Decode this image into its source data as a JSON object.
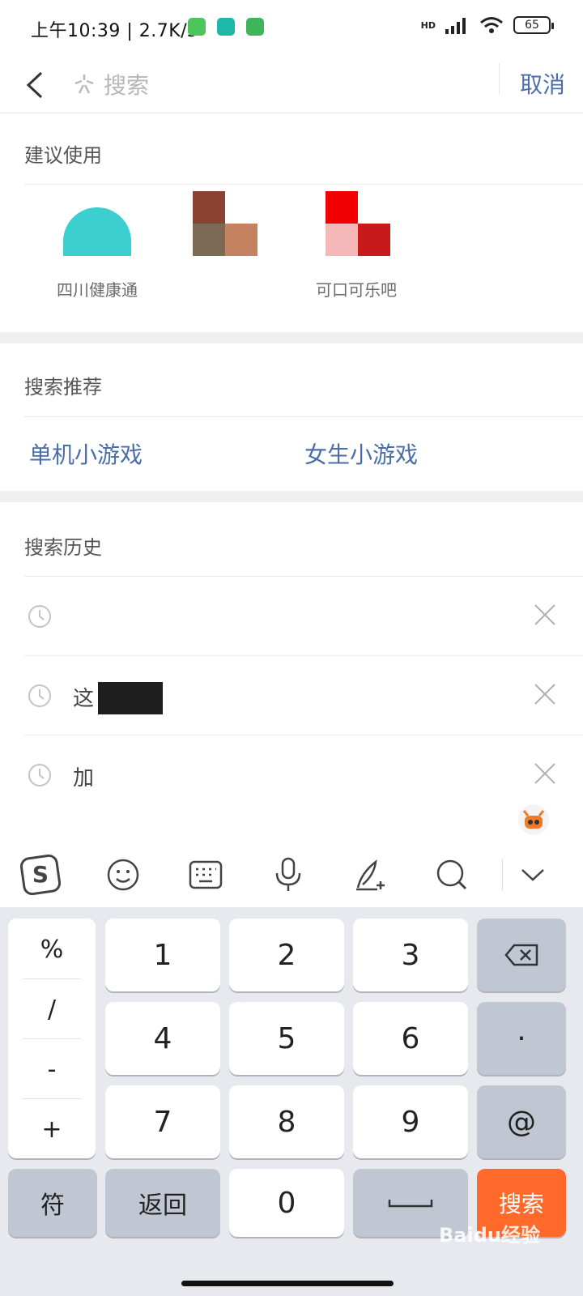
{
  "status_bar": {
    "time": "上午10:39 | 2.7K/s",
    "battery": "65",
    "network_label": "HD"
  },
  "header": {
    "search_placeholder": "搜索",
    "cancel_label": "取消"
  },
  "suggestions": {
    "title": "建议使用",
    "apps": [
      {
        "name": "四川健康通"
      },
      {
        "name": ""
      },
      {
        "name": "可口可乐吧"
      }
    ]
  },
  "recommend": {
    "title": "搜索推荐",
    "items": [
      "单机小游戏",
      "女生小游戏"
    ]
  },
  "history": {
    "title": "搜索历史",
    "items": [
      {
        "text": ""
      },
      {
        "text": "这"
      },
      {
        "text": "加"
      }
    ]
  },
  "keyboard": {
    "symbols": [
      "%",
      "/",
      "-",
      "+"
    ],
    "digits": [
      "1",
      "2",
      "3",
      "4",
      "5",
      "6",
      "7",
      "8",
      "9",
      "0"
    ],
    "dot": "·",
    "at": "@",
    "symbol_key": "符",
    "back_key": "返回",
    "search_key": "搜索"
  },
  "watermark": "Baidu经验",
  "colors": {
    "accent_blue": "#4a6ea8",
    "search_orange": "#ff6a2a"
  }
}
